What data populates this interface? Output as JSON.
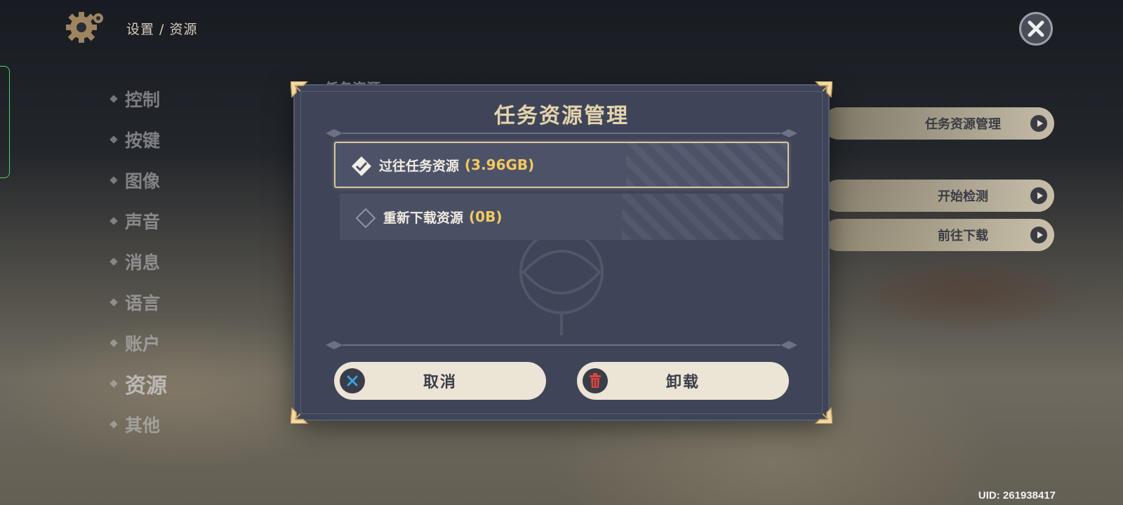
{
  "header": {
    "breadcrumb": "设置 / 资源",
    "icons": {
      "settings": "gear-icon",
      "close": "close-icon"
    }
  },
  "sidebar": {
    "items": [
      {
        "label": "控制"
      },
      {
        "label": "按键"
      },
      {
        "label": "图像"
      },
      {
        "label": "声音"
      },
      {
        "label": "消息"
      },
      {
        "label": "语言"
      },
      {
        "label": "账户"
      },
      {
        "label": "资源",
        "active": true
      },
      {
        "label": "其他"
      }
    ]
  },
  "background_section": {
    "title_peek": "任务资源",
    "actions": [
      {
        "label": "任务资源管理"
      },
      {
        "label": "开始检测"
      },
      {
        "label": "前往下载"
      }
    ]
  },
  "dialog": {
    "title": "任务资源管理",
    "options": [
      {
        "label": "过往任务资源",
        "size": "(3.96GB)",
        "checked": true
      },
      {
        "label": "重新下载资源",
        "size": "(0B)",
        "checked": false
      }
    ],
    "buttons": {
      "cancel": "取消",
      "uninstall": "卸载"
    }
  },
  "footer": {
    "uid": "UID: 261938417"
  },
  "colors": {
    "dialog_bg": "#3f4558",
    "title_gold": "#e4d3ad",
    "size_yellow": "#f4c860",
    "button_bg": "#ece4d5",
    "cancel_icon_blue": "#3aa0e0",
    "uninstall_icon_red": "#e0443c"
  }
}
